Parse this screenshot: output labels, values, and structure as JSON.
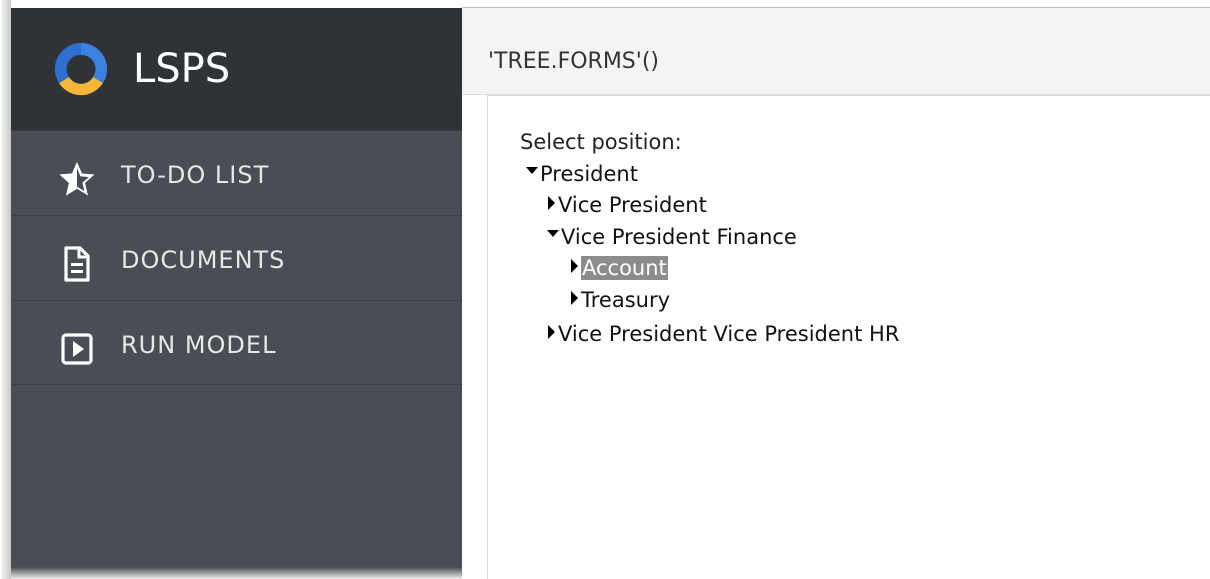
{
  "app": {
    "title": "LSPS"
  },
  "sidebar": {
    "items": [
      {
        "label": "TO-DO LIST",
        "icon": "star-icon"
      },
      {
        "label": "DOCUMENTS",
        "icon": "document-icon"
      },
      {
        "label": "RUN MODEL",
        "icon": "play-icon"
      }
    ]
  },
  "main": {
    "title": "'TREE.FORMS'()",
    "tree_label": "Select position:",
    "tree": [
      {
        "label": "President",
        "expanded": true,
        "selected": false
      },
      {
        "label": "Vice President",
        "expanded": false,
        "selected": false
      },
      {
        "label": "Vice President Finance",
        "expanded": true,
        "selected": false
      },
      {
        "label": "Account",
        "expanded": false,
        "selected": true
      },
      {
        "label": "Treasury",
        "expanded": false,
        "selected": false
      },
      {
        "label": "Vice President Vice President HR",
        "expanded": false,
        "selected": false
      }
    ]
  },
  "colors": {
    "sidebar_bg": "#484e54",
    "sidebar_header_bg": "#2f3236",
    "logo_blue": "#3b82e0",
    "logo_yellow": "#f4b73a",
    "selected_bg": "#8c8c8c"
  }
}
